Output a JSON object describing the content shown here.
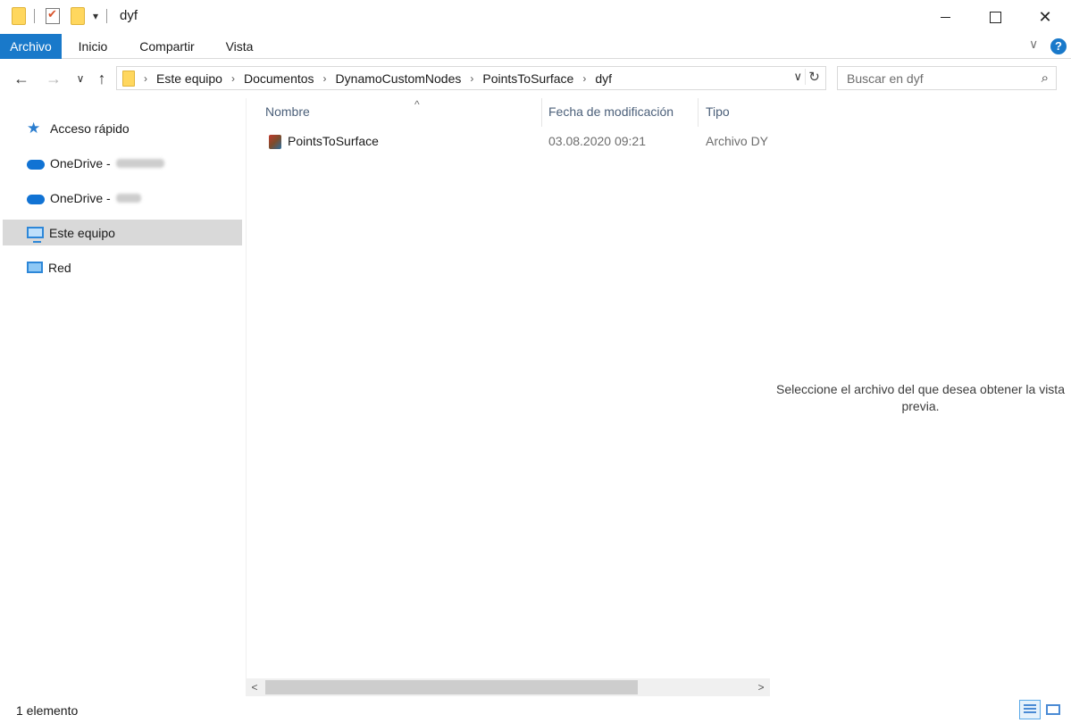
{
  "window": {
    "title": "dyf",
    "minimize_icon": "minimize-icon",
    "maximize_icon": "maximize-icon",
    "close_glyph": "✕"
  },
  "quick_access": {
    "dropdown_glyph": "▾"
  },
  "ribbon": {
    "tabs": [
      "Archivo",
      "Inicio",
      "Compartir",
      "Vista"
    ],
    "expand_glyph": "∨",
    "help_glyph": "?",
    "accent_color": "#1979ca"
  },
  "address_bar": {
    "back_glyph": "←",
    "forward_glyph": "→",
    "recent_glyph": "∨",
    "up_glyph": "↑",
    "crumbs": [
      "Este equipo",
      "Documentos",
      "DynamoCustomNodes",
      "PointsToSurface",
      "dyf"
    ],
    "crumb_separator": "›",
    "dropdown_glyph": "∨",
    "refresh_glyph": "↻"
  },
  "search": {
    "placeholder": "Buscar en dyf",
    "icon_glyph": "⌕"
  },
  "nav_pane": {
    "items": [
      {
        "label": "Acceso rápido",
        "icon": "star-icon"
      },
      {
        "label": "OneDrive -",
        "icon": "onedrive-cloud-icon"
      },
      {
        "label": "OneDrive -",
        "icon": "onedrive-cloud-icon"
      },
      {
        "label": "Este equipo",
        "icon": "computer-icon",
        "selected": true
      },
      {
        "label": "Red",
        "icon": "network-icon"
      }
    ],
    "star_glyph": "★"
  },
  "file_list": {
    "columns": [
      "Nombre",
      "Fecha de modificación",
      "Tipo"
    ],
    "sort_glyph": "^",
    "rows": [
      {
        "name": "PointsToSurface",
        "modified": "03.08.2020 09:21",
        "type": "Archivo DY",
        "icon": "dyf-file-icon"
      }
    ]
  },
  "scrollbar": {
    "left_glyph": "<",
    "right_glyph": ">"
  },
  "preview_pane": {
    "message": "Seleccione el archivo del que desea obtener la vista previa."
  },
  "status_bar": {
    "item_count": "1 elemento"
  }
}
